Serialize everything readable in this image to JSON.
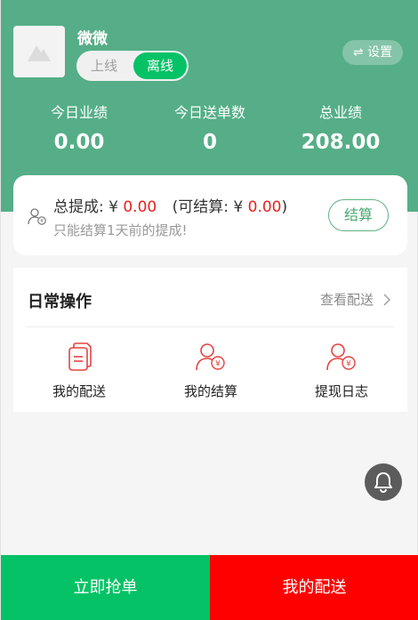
{
  "user": {
    "name": "微微",
    "status_online_label": "上线",
    "status_offline_label": "离线",
    "settings_label": "⇌ 设置"
  },
  "stats": [
    {
      "label": "今日业绩",
      "value": "0.00"
    },
    {
      "label": "今日送单数",
      "value": "0"
    },
    {
      "label": "总业绩",
      "value": "208.00"
    }
  ],
  "commission": {
    "total_label": "总提成: ¥",
    "total_value": "0.00",
    "settleable_open": "(可结算: ¥",
    "settleable_value": "0.00",
    "settleable_close": ")",
    "note": "只能结算1天前的提成!",
    "settle_button": "结算"
  },
  "operations": {
    "title": "日常操作",
    "view_link": "查看配送",
    "items": [
      {
        "label": "我的配送",
        "icon": "document-icon"
      },
      {
        "label": "我的结算",
        "icon": "user-yuan-icon"
      },
      {
        "label": "提现日志",
        "icon": "user-yuan-icon"
      }
    ]
  },
  "bottom": {
    "grab_label": "立即抢单",
    "deliver_label": "我的配送"
  },
  "colors": {
    "header_green": "#55ae87",
    "accent_green": "#06c266",
    "red": "#ff0000",
    "amount_red": "#e7221f"
  }
}
